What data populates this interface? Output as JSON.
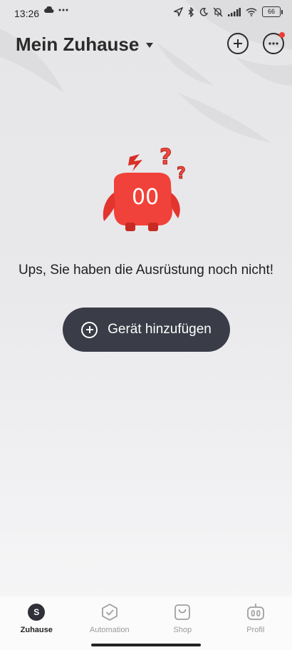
{
  "status_bar": {
    "time": "13:26",
    "battery": "66"
  },
  "header": {
    "title": "Mein Zuhause"
  },
  "empty_state": {
    "message": "Ups, Sie haben die Ausrüstung noch nicht!",
    "illustration_text": "00",
    "button_label": "Gerät hinzufügen"
  },
  "tabs": [
    {
      "label": "Zuhause",
      "icon": "home-avatar-icon",
      "active": true,
      "avatar_letter": "S"
    },
    {
      "label": "Automation",
      "icon": "check-hexagon-icon",
      "active": false
    },
    {
      "label": "Shop",
      "icon": "shopping-bag-icon",
      "active": false
    },
    {
      "label": "Profil",
      "icon": "robot-face-icon",
      "active": false
    }
  ],
  "colors": {
    "accent_red": "#ef3b34",
    "button_dark": "#3a3c47"
  }
}
